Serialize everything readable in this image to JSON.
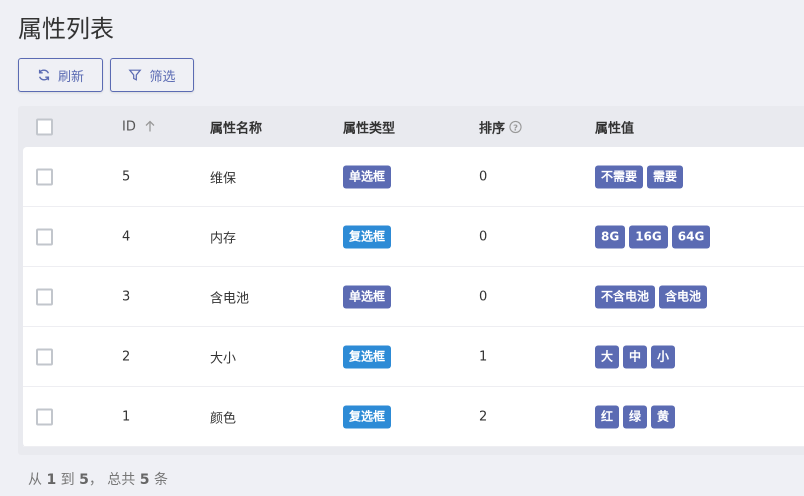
{
  "title": "属性列表",
  "toolbar": {
    "refresh_label": "刷新",
    "filter_label": "筛选"
  },
  "colors": {
    "primary": "#5b6bb3",
    "checkbox_badge": "#2d8bd6"
  },
  "table": {
    "headers": {
      "id": "ID",
      "name": "属性名称",
      "type": "属性类型",
      "sort": "排序",
      "values": "属性值"
    },
    "rows": [
      {
        "id": "5",
        "name": "维保",
        "type": "单选框",
        "type_kind": "single",
        "sort": "0",
        "values": [
          "不需要",
          "需要"
        ]
      },
      {
        "id": "4",
        "name": "内存",
        "type": "复选框",
        "type_kind": "multi",
        "sort": "0",
        "values": [
          "8G",
          "16G",
          "64G"
        ]
      },
      {
        "id": "3",
        "name": "含电池",
        "type": "单选框",
        "type_kind": "single",
        "sort": "0",
        "values": [
          "不含电池",
          "含电池"
        ]
      },
      {
        "id": "2",
        "name": "大小",
        "type": "复选框",
        "type_kind": "multi",
        "sort": "1",
        "values": [
          "大",
          "中",
          "小"
        ]
      },
      {
        "id": "1",
        "name": "颜色",
        "type": "复选框",
        "type_kind": "multi",
        "sort": "2",
        "values": [
          "红",
          "绿",
          "黄"
        ]
      }
    ]
  },
  "pagination": {
    "prefix": "从",
    "from": "1",
    "to_word": "到",
    "to": "5",
    "total_word": "，  总共",
    "total": "5",
    "suffix": "条"
  }
}
